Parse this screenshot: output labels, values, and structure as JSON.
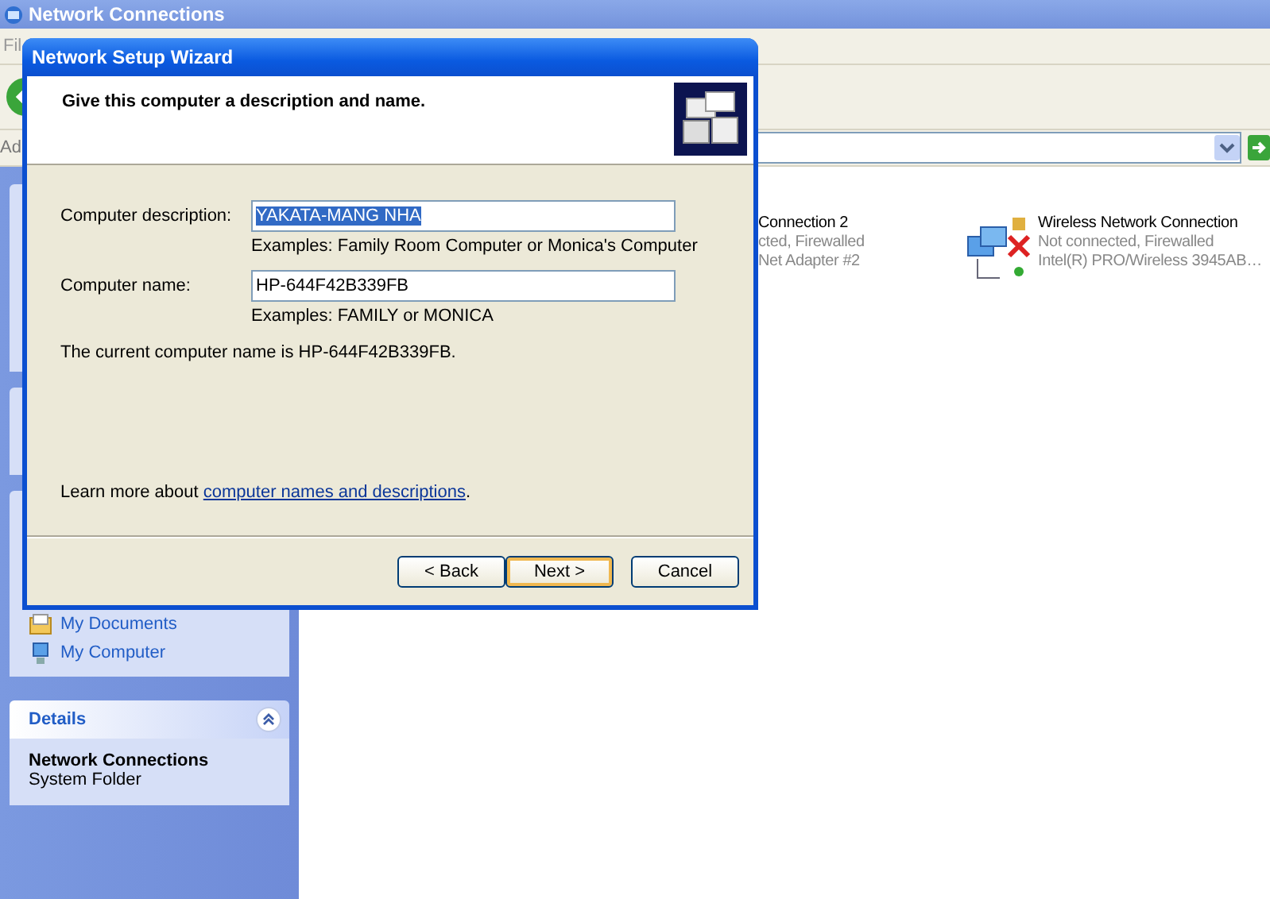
{
  "explorer": {
    "title": "Network Connections",
    "menu_fragment": "Fil",
    "address_label": "Ad",
    "connections": [
      {
        "kind": "partial",
        "name": "Connection 2",
        "status": "cted, Firewalled",
        "device": "Net Adapter #2"
      },
      {
        "kind": "wireless",
        "name": "Wireless Network Connection",
        "status": "Not connected, Firewalled",
        "device": "Intel(R) PRO/Wireless 3945AB…"
      }
    ],
    "other_places": [
      {
        "kind": "documents",
        "label": "My Documents"
      },
      {
        "kind": "computer",
        "label": "My Computer"
      }
    ],
    "details": {
      "title": "Details",
      "expanded": true,
      "name": "Network Connections",
      "type": "System Folder"
    }
  },
  "wizard": {
    "title": "Network Setup Wizard",
    "heading": "Give this computer a description and name.",
    "fields": [
      {
        "label": "Computer description:",
        "value": "YAKATA-MANG NHA",
        "selected": true,
        "hint": "Examples: Family Room Computer or Monica's Computer"
      },
      {
        "label": "Computer name:",
        "value": "HP-644F42B339FB",
        "selected": false,
        "hint": "Examples: FAMILY or MONICA"
      }
    ],
    "current_name": "The current computer name is HP-644F42B339FB.",
    "learn_more": "Learn more about ",
    "learn_link": "computer names and descriptions",
    "learn_end": ".",
    "buttons": [
      {
        "label": "< Back",
        "default": false
      },
      {
        "label": "Next >",
        "default": true
      },
      {
        "label": "Cancel",
        "default": false
      }
    ]
  }
}
